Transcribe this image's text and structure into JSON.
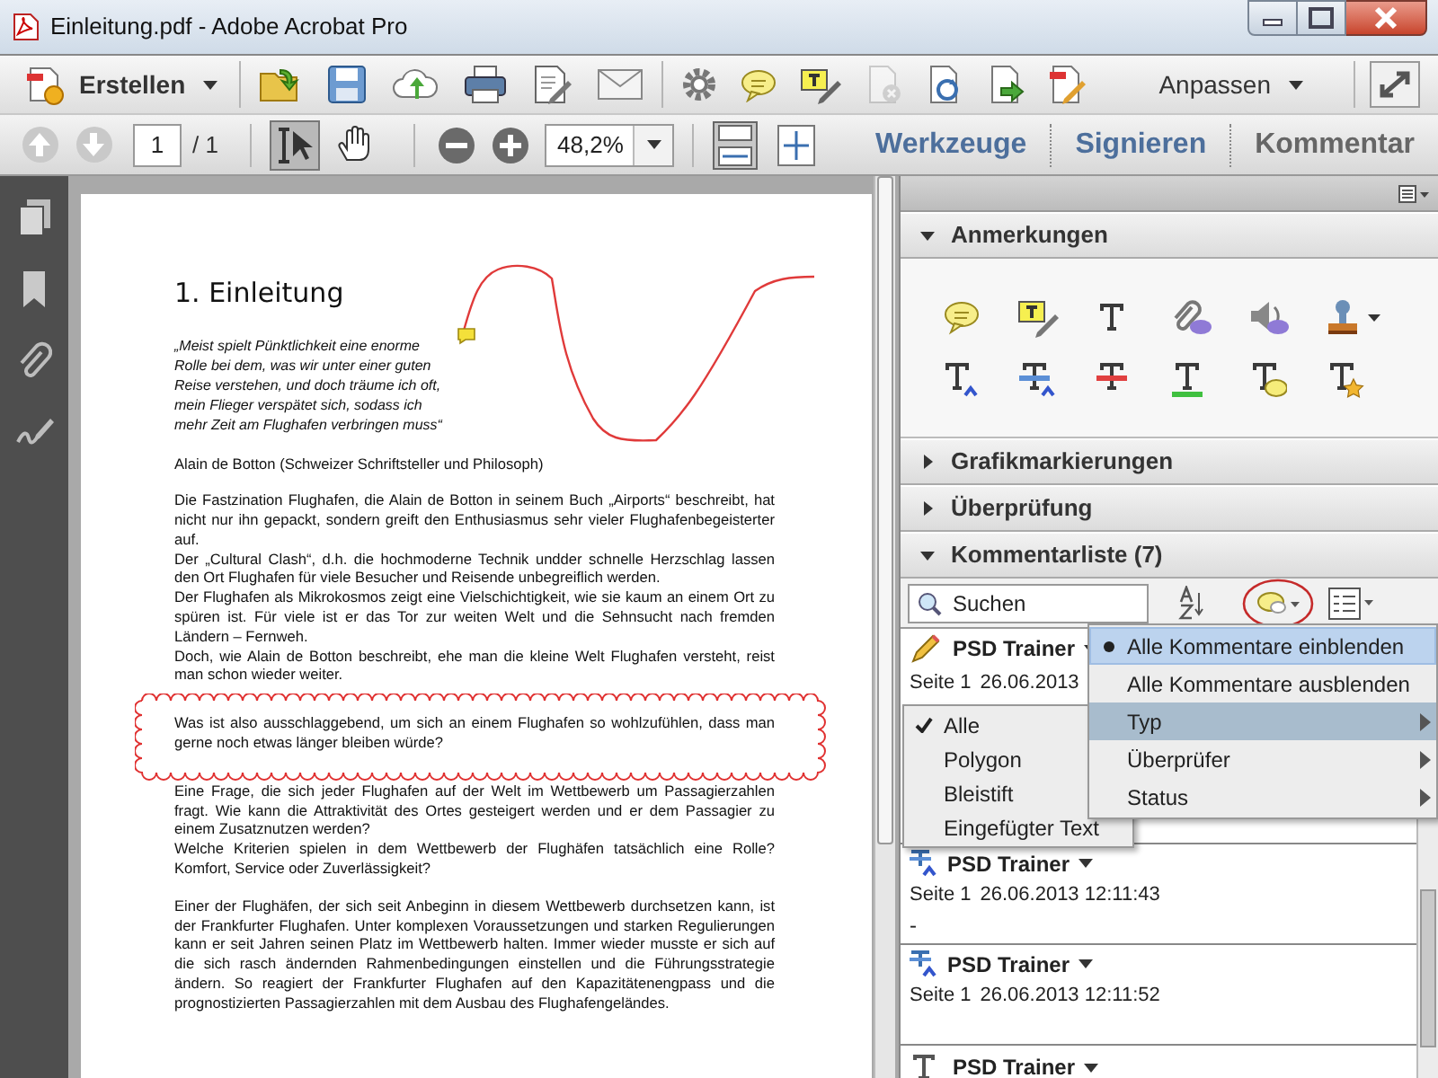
{
  "window": {
    "title": "Einleitung.pdf - Adobe Acrobat Pro"
  },
  "toolbar": {
    "create_button": "Erstellen",
    "customize_button": "Anpassen",
    "disabled_icon": true
  },
  "nav_bar": {
    "page_buttons": [
      {
        "kind": "up",
        "disabled": true
      },
      {
        "kind": "down",
        "disabled": true
      }
    ],
    "page": "1",
    "page_count": "/ 1",
    "tools": [
      {
        "kind": "select",
        "pressed": true
      },
      {
        "kind": "hand",
        "pressed": false
      }
    ],
    "zoom": "48,2%",
    "tabs": [
      {
        "label": "Werkzeuge",
        "selected": false
      },
      {
        "label": "Signieren",
        "selected": false
      },
      {
        "label": "Kommentar",
        "selected": true
      }
    ]
  },
  "document": {
    "blocks": [
      {
        "kind": "heading",
        "text": "1. Einleitung"
      },
      {
        "kind": "quote",
        "lines": [
          "„Meist spielt Pünktlichkeit eine enorme",
          "Rolle bei dem, was wir unter einer guten",
          "Reise verstehen, und doch träume ich oft,",
          "mein Flieger verspätet sich, sodass ich",
          "mehr Zeit am Flughafen verbringen muss“"
        ]
      },
      {
        "kind": "text",
        "paragraphs": [
          "Alain de Botton (Schweizer Schriftsteller und Philosoph)"
        ]
      },
      {
        "kind": "text",
        "paragraphs": [
          "Die Fastzination Flughafen, die Alain de Botton in seinem Buch „Airports“ beschreibt, hat nicht nur ihn gepackt, sondern greift den Enthusiasmus sehr vieler Flughafenbegeisterter auf.",
          "Der „Cultural Clash“, d.h. die hochmoderne Technik undder schnelle Herzschlag lassen den Ort Flughafen für viele Besucher und Reisende unbegreiflich werden.",
          "Der Flughafen als Mikrokosmos zeigt eine Vielschichtigkeit, wie sie kaum an einem Ort zu spüren ist. Für viele ist er das Tor zur weiten Welt und die Sehnsucht nach fremden Ländern – Fernweh.",
          "Doch, wie Alain de Botton beschreibt, ehe man die kleine Welt Flughafen versteht, reist man schon wieder weiter."
        ]
      },
      {
        "kind": "cloud",
        "paragraphs": [
          "Was ist also ausschlaggebend, um sich an einem Flughafen so wohlzufühlen, dass man gerne noch etwas länger bleiben würde?"
        ]
      },
      {
        "kind": "text",
        "paragraphs": [
          "Eine Frage, die sich jeder Flughafen auf der Welt im Wettbewerb um Passagierzahlen fragt. Wie kann die Attraktivität des Ortes gesteigert werden und er dem Passagier zu einem Zusatznutzen werden?",
          "Welche Kriterien spielen in dem Wettbewerb der Flughäfen tatsächlich eine Rolle? Komfort, Service oder Zuverlässigkeit?"
        ]
      },
      {
        "kind": "text",
        "paragraphs": [
          "Einer der Flughäfen, der sich seit Anbeginn in diesem Wettbewerb durchsetzen kann, ist der Frankfurter Flughafen. Unter komplexen Voraussetzungen und starken Regulierungen kann er seit Jahren seinen Platz im Wettbewerb halten. Immer wieder musste er sich auf die sich rasch ändernden Rahmenbedingungen einstellen und die Führungsstrategie ändern.  So reagiert der Frankfurter Flughafen auf den Kapazitätenengpass und die prognostizierten Passagierzahlen mit dem Ausbau des Flughafengeländes."
        ]
      }
    ]
  },
  "panel": {
    "sections": [
      {
        "title": "Anmerkungen",
        "expanded": true
      },
      {
        "title": "Grafikmarkierungen",
        "expanded": false
      },
      {
        "title": "Überprüfung",
        "expanded": false
      },
      {
        "title": "Kommentarliste (7)",
        "expanded": true
      }
    ],
    "search": {
      "placeholder": "Suchen"
    },
    "comments": [
      {
        "kind": "pencil",
        "author": "PSD Trainer",
        "page": "Seite 1",
        "date": "26.06.2013"
      },
      {
        "kind": "insert",
        "author": "PSD Trainer",
        "page": "Seite 1",
        "date": "26.06.2013 12:11:43",
        "body": "-"
      },
      {
        "kind": "insert",
        "author": "PSD Trainer",
        "page": "Seite 1",
        "date": "26.06.2013 12:11:52"
      },
      {
        "kind": "text",
        "author": "PSD Trainer"
      }
    ]
  },
  "menu": {
    "items": [
      {
        "label": "Alle Kommentare einblenden",
        "checked": true,
        "hovered": true,
        "selected": false,
        "submenu": false
      },
      {
        "label": "Alle Kommentare ausblenden",
        "checked": false,
        "hovered": false,
        "selected": false,
        "submenu": false
      },
      {
        "label": "Typ",
        "checked": false,
        "hovered": false,
        "selected": true,
        "submenu": true
      },
      {
        "label": "Überprüfer",
        "checked": false,
        "hovered": false,
        "selected": false,
        "submenu": true
      },
      {
        "label": "Status",
        "checked": false,
        "hovered": false,
        "selected": false,
        "submenu": true
      }
    ]
  },
  "submenu": {
    "items": [
      {
        "label": "Alle",
        "checked": true
      },
      {
        "label": "Polygon",
        "checked": false
      },
      {
        "label": "Bleistift",
        "checked": false
      },
      {
        "label": "Eingefügter Text",
        "checked": false
      }
    ]
  }
}
